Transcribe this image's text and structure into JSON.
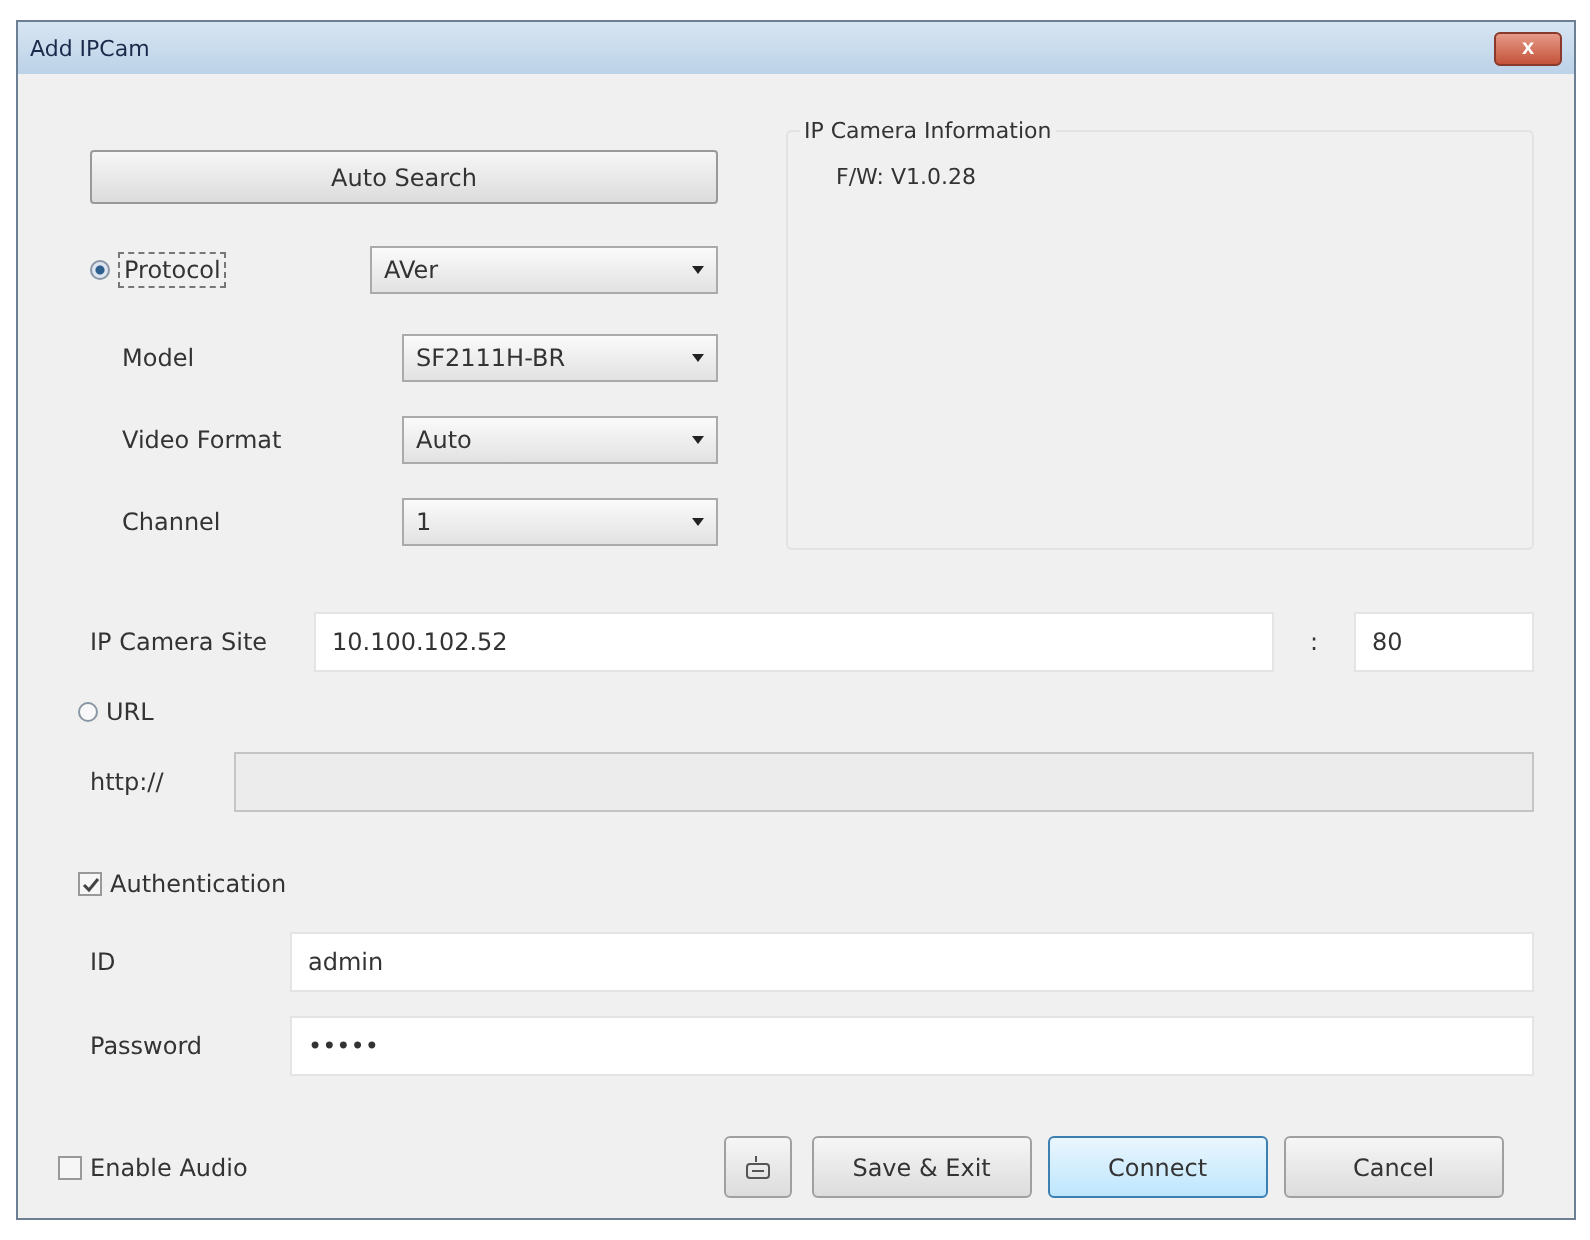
{
  "window": {
    "title": "Add IPCam",
    "close_label": "x"
  },
  "auto_search": {
    "label": "Auto Search"
  },
  "protocol": {
    "label": "Protocol",
    "selected": true,
    "focused": true,
    "value": "AVer"
  },
  "selects": [
    {
      "label": "Model",
      "value": "SF2111H-BR"
    },
    {
      "label": "Video Format",
      "value": "Auto"
    },
    {
      "label": "Channel",
      "value": "1"
    }
  ],
  "camera_info": {
    "title": "IP Camera Information",
    "lines": [
      "F/W: V1.0.28"
    ]
  },
  "site": {
    "label": "IP Camera Site",
    "value": "10.100.102.52",
    "separator": ":",
    "port": "80"
  },
  "url": {
    "label": "URL",
    "selected": false,
    "prefix": "http://",
    "disabled": true
  },
  "authentication": {
    "label": "Authentication",
    "checked": true
  },
  "credentials": [
    {
      "label": "ID",
      "value": "admin"
    },
    {
      "label": "Password",
      "value": "•••••"
    }
  ],
  "enable_audio": {
    "label": "Enable Audio",
    "checked": false
  },
  "buttons": [
    {
      "label": "Save & Exit",
      "default": false
    },
    {
      "label": "Connect",
      "default": true
    },
    {
      "label": "Cancel",
      "default": false
    }
  ]
}
